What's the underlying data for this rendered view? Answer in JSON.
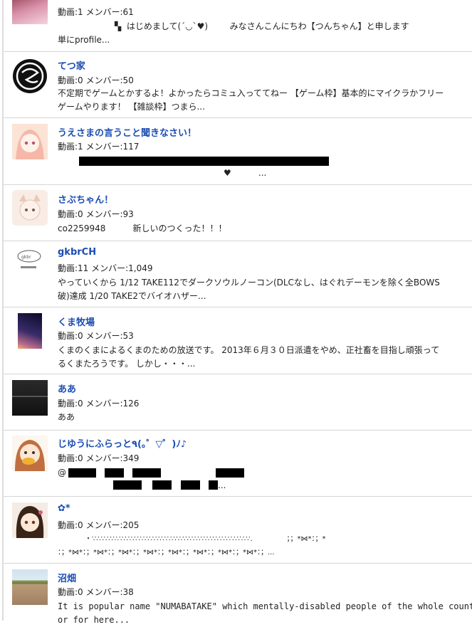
{
  "items": [
    {
      "stats": "動画:1 メンバー:61",
      "desc_line1": "▚  はじめまして(´◡`♥)        みなさんこんにちわ【つんちゃん】と申します",
      "desc_line2": "単にprofile..."
    },
    {
      "name": "てつ家",
      "stats": "動画:0 メンバー:50",
      "desc_line1": "不定期でゲームとかするよ！よかったらコミュ入っててねー 【ゲーム枠】基本的にマイクラかフリー",
      "desc_line2": "ゲームやります！ 【雑談枠】つまら..."
    },
    {
      "name": "うえさまの言うこと聞きなさい！",
      "stats": "動画:1 メンバー:117",
      "desc_line2": "♥          ..."
    },
    {
      "name": "さぶちゃん！",
      "stats": "動画:0 メンバー:93",
      "desc_line1": "co2259948          新しいのつくった！！！"
    },
    {
      "name": "gkbrCH",
      "stats": "動画:11 メンバー:1,049",
      "desc_line1": "やっていくから 1/12 TAKE112でダークソウルノーコン(DLCなし、はぐれデーモンを除く全BOWS",
      "desc_line2": "破)達成 1/20 TAKE2でバイオハザー..."
    },
    {
      "name": "くま牧場",
      "stats": "動画:0 メンバー:53",
      "desc_line1": "くまのくまによるくまのための放送です。 2013年６月３０日派遣をやめ、正社畜を目指し頑張って",
      "desc_line2": "るくまたろうです。 しかし・・・..."
    },
    {
      "name": "ああ",
      "stats": "動画:0 メンバー:126",
      "desc_line1": "ああ"
    },
    {
      "name": "じゆうにふらっと٩(｡゜▽゜)ﾉ♪",
      "stats": "動画:0 メンバー:349",
      "desc_line1": "@",
      "desc_line2": "..."
    },
    {
      "name": "✿*",
      "stats": "動画:0 メンバー:205",
      "desc_line1": "・∵∴∵∴∵∴∵∴∵∴∵∴∵∴∵∴∵∴∵∴∵∴∵∴∵∴∵∴∵∴∵∴∵∴∵.               ；；*⋈*：；*",
      "desc_line2": "：；*⋈*：；*⋈*：；*⋈*：；*⋈*：；*⋈*：；*⋈*：；*⋈*：；*⋈*：；..."
    },
    {
      "name": "沼畑",
      "stats": "動画:0 メンバー:38",
      "desc_line1": "It is popular name \"NUMABATAKE\" which mentally-disabled people of the whole country ga",
      "desc_line2": "or for here..."
    }
  ]
}
